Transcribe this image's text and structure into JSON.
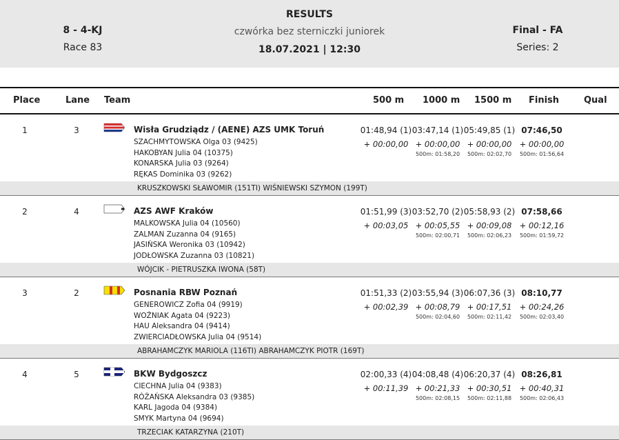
{
  "header": {
    "event_code": "8 - 4-KJ",
    "race": "Race 83",
    "title": "RESULTS",
    "subtitle": "czwórka bez sterniczki juniorek",
    "datetime": "18.07.2021 | 12:30",
    "phase": "Final - FA",
    "series": "Series: 2"
  },
  "columns": {
    "place": "Place",
    "lane": "Lane",
    "team": "Team",
    "m500": "500 m",
    "m1000": "1000 m",
    "m1500": "1500 m",
    "finish": "Finish",
    "qual": "Qual"
  },
  "entries": [
    {
      "place": "1",
      "lane": "3",
      "flag": "flag-red-white-blue-icon",
      "team": "Wisła Grudziądz / (AENE) AZS UMK Toruń",
      "crew": [
        "SZACHMYTOWSKA  Olga 03 (9425)",
        "HAKOBYAN  Julia 04 (10375)",
        "KONARSKA  Julia 03 (9264)",
        "RĘKAS  Dominika 03 (9262)"
      ],
      "coach": "KRUSZKOWSKI SŁAWOMIR (151TI) WIŚNIEWSKI SZYMON (199T)",
      "m500": {
        "time": "01:48,94 (1)",
        "diff": "+ 00:00,00"
      },
      "m1000": {
        "time": "03:47,14 (1)",
        "diff": "+ 00:00,00",
        "pace": "500m: 01:58,20"
      },
      "m1500": {
        "time": "05:49,85 (1)",
        "diff": "+ 00:00,00",
        "pace": "500m: 02:02,70"
      },
      "finish": {
        "time": "07:46,50",
        "diff": "+ 00:00,00",
        "pace": "500m: 01:56,64"
      }
    },
    {
      "place": "2",
      "lane": "4",
      "flag": "flag-white-icon",
      "team": "AZS AWF Kraków",
      "crew": [
        "MALKOWSKA  Julia 04 (10560)",
        "ZALMAN  Zuzanna 04 (9165)",
        "JASIŃSKA  Weronika 03 (10942)",
        "JODŁOWSKA  Zuzanna 03 (10821)"
      ],
      "coach": "WÓJCIK - PIETRUSZKA IWONA (58T)",
      "m500": {
        "time": "01:51,99 (3)",
        "diff": "+ 00:03,05"
      },
      "m1000": {
        "time": "03:52,70 (2)",
        "diff": "+ 00:05,55",
        "pace": "500m: 02:00,71"
      },
      "m1500": {
        "time": "05:58,93 (2)",
        "diff": "+ 00:09,08",
        "pace": "500m: 02:06,23"
      },
      "finish": {
        "time": "07:58,66",
        "diff": "+ 00:12,16",
        "pace": "500m: 01:59,72"
      }
    },
    {
      "place": "3",
      "lane": "2",
      "flag": "flag-yellow-red-icon",
      "team": "Posnania RBW Poznań",
      "crew": [
        "GENEROWICZ  Zofia 04 (9919)",
        "WOŹNIAK  Agata 04 (9223)",
        "HAU  Aleksandra 04 (9414)",
        "ZWIERCIADŁOWSKA  Julia 04 (9514)"
      ],
      "coach": "ABRAHAMCZYK MARIOLA (116TI) ABRAHAMCZYK PIOTR (169T)",
      "m500": {
        "time": "01:51,33 (2)",
        "diff": "+ 00:02,39"
      },
      "m1000": {
        "time": "03:55,94 (3)",
        "diff": "+ 00:08,79",
        "pace": "500m: 02:04,60"
      },
      "m1500": {
        "time": "06:07,36 (3)",
        "diff": "+ 00:17,51",
        "pace": "500m: 02:11,42"
      },
      "finish": {
        "time": "08:10,77",
        "diff": "+ 00:24,26",
        "pace": "500m: 02:03,40"
      }
    },
    {
      "place": "4",
      "lane": "5",
      "flag": "flag-navy-white-icon",
      "team": "BKW Bydgoszcz",
      "crew": [
        "CIECHNA  Julia 04 (9383)",
        "RÓŻAŃSKA  Aleksandra 03 (9385)",
        "KARL  Jagoda 04 (9384)",
        "SMYK  Martyna 04 (9694)"
      ],
      "coach": "TRZECIAK KATARZYNA (210T)",
      "m500": {
        "time": "02:00,33 (4)",
        "diff": "+ 00:11,39"
      },
      "m1000": {
        "time": "04:08,48 (4)",
        "diff": "+ 00:21,33",
        "pace": "500m: 02:08,15"
      },
      "m1500": {
        "time": "06:20,37 (4)",
        "diff": "+ 00:30,51",
        "pace": "500m: 02:11,88"
      },
      "finish": {
        "time": "08:26,81",
        "diff": "+ 00:40,31",
        "pace": "500m: 02:06,43"
      }
    }
  ]
}
